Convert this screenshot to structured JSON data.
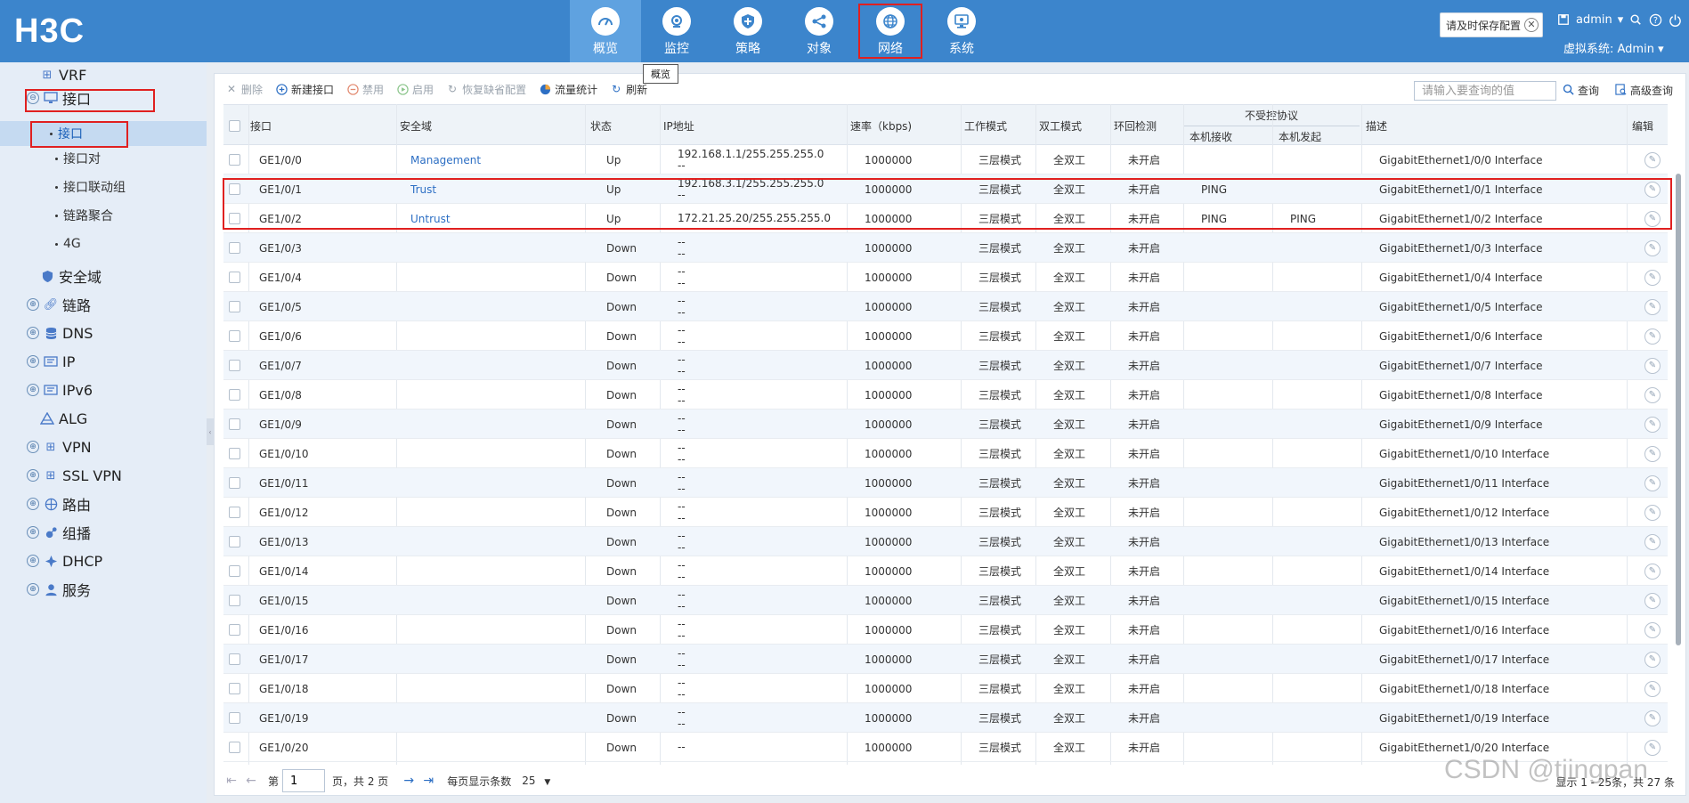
{
  "header": {
    "logo": "H3C",
    "nav": [
      {
        "label": "概览",
        "icon": "dashboard-icon",
        "active": true
      },
      {
        "label": "监控",
        "icon": "monitor-icon",
        "active": false
      },
      {
        "label": "策略",
        "icon": "shield-icon",
        "active": false
      },
      {
        "label": "对象",
        "icon": "share-icon",
        "active": false
      },
      {
        "label": "网络",
        "icon": "globe-icon",
        "active": false
      },
      {
        "label": "系统",
        "icon": "system-icon",
        "active": false
      }
    ],
    "tooltip": "概览",
    "save_hint": "请及时保存配置",
    "user": "admin",
    "virtual_system": "虚拟系统: Admin"
  },
  "sidebar": {
    "items": [
      {
        "label": "VRF",
        "icon": "vrf-icon",
        "expandable": false
      },
      {
        "label": "接口",
        "icon": "monitor-icon",
        "expandable": true
      },
      {
        "label": "安全域",
        "icon": "shield-icon",
        "expandable": false
      },
      {
        "label": "链路",
        "icon": "link-icon",
        "expandable": true
      },
      {
        "label": "DNS",
        "icon": "database-icon",
        "expandable": true
      },
      {
        "label": "IP",
        "icon": "ip-icon",
        "expandable": true
      },
      {
        "label": "IPv6",
        "icon": "ipv6-icon",
        "expandable": true
      },
      {
        "label": "ALG",
        "icon": "alg-icon",
        "expandable": false
      },
      {
        "label": "VPN",
        "icon": "vpn-icon",
        "expandable": true
      },
      {
        "label": "SSL VPN",
        "icon": "sslvpn-icon",
        "expandable": true
      },
      {
        "label": "路由",
        "icon": "route-icon",
        "expandable": true
      },
      {
        "label": "组播",
        "icon": "multicast-icon",
        "expandable": true
      },
      {
        "label": "DHCP",
        "icon": "dhcp-icon",
        "expandable": true
      },
      {
        "label": "服务",
        "icon": "service-icon",
        "expandable": true
      }
    ],
    "sub_items": [
      "接口",
      "接口对",
      "接口联动组",
      "链路聚合",
      "4G"
    ],
    "selected_sub": "接口"
  },
  "toolbar": {
    "delete": "删除",
    "new_interface": "新建接口",
    "disable": "禁用",
    "enable": "启用",
    "restore_default": "恢复缺省配置",
    "traffic_stats": "流量统计",
    "refresh": "刷新",
    "search_placeholder": "请输入要查询的值",
    "search": "查询",
    "advanced_search": "高级查询"
  },
  "table": {
    "headers": {
      "interface": "接口",
      "zone": "安全域",
      "status": "状态",
      "ip": "IP地址",
      "speed": "速率（kbps)",
      "work_mode": "工作模式",
      "duplex": "双工模式",
      "loop_detect": "环回检测",
      "uncontrolled": "不受控协议",
      "local_recv": "本机接收",
      "local_send": "本机发起",
      "description": "描述",
      "edit": "编辑"
    },
    "rows": [
      {
        "iface": "GE1/0/0",
        "zone": "Management",
        "status": "Up",
        "ip1": "192.168.1.1/255.255.255.0",
        "ip2": "--",
        "speed": "1000000",
        "mode": "三层模式",
        "duplex": "全双工",
        "loop": "未开启",
        "recv": "",
        "send": "",
        "desc": "GigabitEthernet1/0/0 Interface"
      },
      {
        "iface": "GE1/0/1",
        "zone": "Trust",
        "status": "Up",
        "ip1": "192.168.3.1/255.255.255.0",
        "ip2": "--",
        "speed": "1000000",
        "mode": "三层模式",
        "duplex": "全双工",
        "loop": "未开启",
        "recv": "PING",
        "send": "",
        "desc": "GigabitEthernet1/0/1 Interface"
      },
      {
        "iface": "GE1/0/2",
        "zone": "Untrust",
        "status": "Up",
        "ip1": "172.21.25.20/255.255.255.0",
        "ip2": "",
        "speed": "1000000",
        "mode": "三层模式",
        "duplex": "全双工",
        "loop": "未开启",
        "recv": "PING",
        "send": "PING",
        "desc": "GigabitEthernet1/0/2 Interface"
      },
      {
        "iface": "GE1/0/3",
        "zone": "",
        "status": "Down",
        "ip1": "--",
        "ip2": "--",
        "speed": "1000000",
        "mode": "三层模式",
        "duplex": "全双工",
        "loop": "未开启",
        "recv": "",
        "send": "",
        "desc": "GigabitEthernet1/0/3 Interface"
      },
      {
        "iface": "GE1/0/4",
        "zone": "",
        "status": "Down",
        "ip1": "--",
        "ip2": "--",
        "speed": "1000000",
        "mode": "三层模式",
        "duplex": "全双工",
        "loop": "未开启",
        "recv": "",
        "send": "",
        "desc": "GigabitEthernet1/0/4 Interface"
      },
      {
        "iface": "GE1/0/5",
        "zone": "",
        "status": "Down",
        "ip1": "--",
        "ip2": "--",
        "speed": "1000000",
        "mode": "三层模式",
        "duplex": "全双工",
        "loop": "未开启",
        "recv": "",
        "send": "",
        "desc": "GigabitEthernet1/0/5 Interface"
      },
      {
        "iface": "GE1/0/6",
        "zone": "",
        "status": "Down",
        "ip1": "--",
        "ip2": "--",
        "speed": "1000000",
        "mode": "三层模式",
        "duplex": "全双工",
        "loop": "未开启",
        "recv": "",
        "send": "",
        "desc": "GigabitEthernet1/0/6 Interface"
      },
      {
        "iface": "GE1/0/7",
        "zone": "",
        "status": "Down",
        "ip1": "--",
        "ip2": "--",
        "speed": "1000000",
        "mode": "三层模式",
        "duplex": "全双工",
        "loop": "未开启",
        "recv": "",
        "send": "",
        "desc": "GigabitEthernet1/0/7 Interface"
      },
      {
        "iface": "GE1/0/8",
        "zone": "",
        "status": "Down",
        "ip1": "--",
        "ip2": "--",
        "speed": "1000000",
        "mode": "三层模式",
        "duplex": "全双工",
        "loop": "未开启",
        "recv": "",
        "send": "",
        "desc": "GigabitEthernet1/0/8 Interface"
      },
      {
        "iface": "GE1/0/9",
        "zone": "",
        "status": "Down",
        "ip1": "--",
        "ip2": "--",
        "speed": "1000000",
        "mode": "三层模式",
        "duplex": "全双工",
        "loop": "未开启",
        "recv": "",
        "send": "",
        "desc": "GigabitEthernet1/0/9 Interface"
      },
      {
        "iface": "GE1/0/10",
        "zone": "",
        "status": "Down",
        "ip1": "--",
        "ip2": "--",
        "speed": "1000000",
        "mode": "三层模式",
        "duplex": "全双工",
        "loop": "未开启",
        "recv": "",
        "send": "",
        "desc": "GigabitEthernet1/0/10 Interface"
      },
      {
        "iface": "GE1/0/11",
        "zone": "",
        "status": "Down",
        "ip1": "--",
        "ip2": "--",
        "speed": "1000000",
        "mode": "三层模式",
        "duplex": "全双工",
        "loop": "未开启",
        "recv": "",
        "send": "",
        "desc": "GigabitEthernet1/0/11 Interface"
      },
      {
        "iface": "GE1/0/12",
        "zone": "",
        "status": "Down",
        "ip1": "--",
        "ip2": "--",
        "speed": "1000000",
        "mode": "三层模式",
        "duplex": "全双工",
        "loop": "未开启",
        "recv": "",
        "send": "",
        "desc": "GigabitEthernet1/0/12 Interface"
      },
      {
        "iface": "GE1/0/13",
        "zone": "",
        "status": "Down",
        "ip1": "--",
        "ip2": "--",
        "speed": "1000000",
        "mode": "三层模式",
        "duplex": "全双工",
        "loop": "未开启",
        "recv": "",
        "send": "",
        "desc": "GigabitEthernet1/0/13 Interface"
      },
      {
        "iface": "GE1/0/14",
        "zone": "",
        "status": "Down",
        "ip1": "--",
        "ip2": "--",
        "speed": "1000000",
        "mode": "三层模式",
        "duplex": "全双工",
        "loop": "未开启",
        "recv": "",
        "send": "",
        "desc": "GigabitEthernet1/0/14 Interface"
      },
      {
        "iface": "GE1/0/15",
        "zone": "",
        "status": "Down",
        "ip1": "--",
        "ip2": "--",
        "speed": "1000000",
        "mode": "三层模式",
        "duplex": "全双工",
        "loop": "未开启",
        "recv": "",
        "send": "",
        "desc": "GigabitEthernet1/0/15 Interface"
      },
      {
        "iface": "GE1/0/16",
        "zone": "",
        "status": "Down",
        "ip1": "--",
        "ip2": "--",
        "speed": "1000000",
        "mode": "三层模式",
        "duplex": "全双工",
        "loop": "未开启",
        "recv": "",
        "send": "",
        "desc": "GigabitEthernet1/0/16 Interface"
      },
      {
        "iface": "GE1/0/17",
        "zone": "",
        "status": "Down",
        "ip1": "--",
        "ip2": "--",
        "speed": "1000000",
        "mode": "三层模式",
        "duplex": "全双工",
        "loop": "未开启",
        "recv": "",
        "send": "",
        "desc": "GigabitEthernet1/0/17 Interface"
      },
      {
        "iface": "GE1/0/18",
        "zone": "",
        "status": "Down",
        "ip1": "--",
        "ip2": "--",
        "speed": "1000000",
        "mode": "三层模式",
        "duplex": "全双工",
        "loop": "未开启",
        "recv": "",
        "send": "",
        "desc": "GigabitEthernet1/0/18 Interface"
      },
      {
        "iface": "GE1/0/19",
        "zone": "",
        "status": "Down",
        "ip1": "--",
        "ip2": "--",
        "speed": "1000000",
        "mode": "三层模式",
        "duplex": "全双工",
        "loop": "未开启",
        "recv": "",
        "send": "",
        "desc": "GigabitEthernet1/0/19 Interface"
      },
      {
        "iface": "GE1/0/20",
        "zone": "",
        "status": "Down",
        "ip1": "--",
        "ip2": "",
        "speed": "1000000",
        "mode": "三层模式",
        "duplex": "全双工",
        "loop": "未开启",
        "recv": "",
        "send": "",
        "desc": "GigabitEthernet1/0/20 Interface"
      }
    ]
  },
  "pager": {
    "page_prefix": "第",
    "page_value": "1",
    "page_suffix": "页，共 2 页",
    "per_page_label": "每页显示条数",
    "per_page_value": "25",
    "summary": "显示 1 - 25条，共 27 条"
  },
  "watermark": "CSDN @tjingpan",
  "colors": {
    "header_bg": "#3c85cc",
    "nav_active": "#5fa2e0",
    "sidebar_bg": "#e5edf7",
    "selected_bg": "#c5daf1",
    "zone_link": "#2d6fc4",
    "highlight_box": "#e02020"
  }
}
